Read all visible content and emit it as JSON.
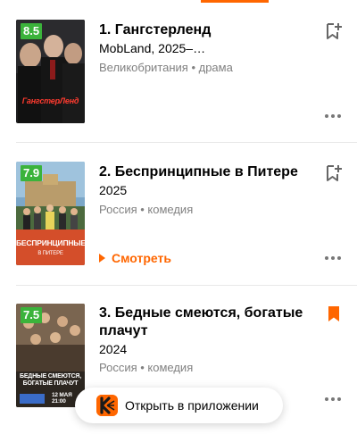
{
  "colors": {
    "accent": "#ff6600",
    "rating_badge": "#3bb33b",
    "meta_text": "#808080",
    "divider": "#e8e8e8"
  },
  "items": [
    {
      "rank_title": "1. Гангстерленд",
      "subtitle": "MobLand, 2025–…",
      "meta": "Великобритания • драма",
      "rating": "8.5",
      "poster_title": "ГангстерЛенд",
      "bookmarked": false,
      "bookmark_icon": "bookmark-add-icon",
      "more_icon": "more-icon"
    },
    {
      "rank_title": "2. Беспринципные в Питере",
      "subtitle": "2025",
      "meta": "Россия • комедия",
      "rating": "7.9",
      "poster_title": "БЕСПРИНЦИПНЫЕ",
      "poster_subtitle": "В ПИТЕРЕ",
      "watch_label": "Смотреть",
      "bookmarked": false,
      "bookmark_icon": "bookmark-add-icon",
      "more_icon": "more-icon"
    },
    {
      "rank_title": "3. Бедные смеются, богатые плачут",
      "subtitle": "2024",
      "meta": "Россия • комедия",
      "rating": "7.5",
      "poster_title": "БЕДНЫЕ СМЕЮТСЯ, БОГАТЫЕ ПЛАЧУТ",
      "poster_date": "12 МАЯ",
      "poster_time": "21:00",
      "bookmarked": true,
      "bookmark_icon": "bookmark-filled-icon",
      "more_icon": "more-icon"
    }
  ],
  "open_app": {
    "label": "Открыть в приложении",
    "icon": "kinopoisk-app-icon"
  }
}
